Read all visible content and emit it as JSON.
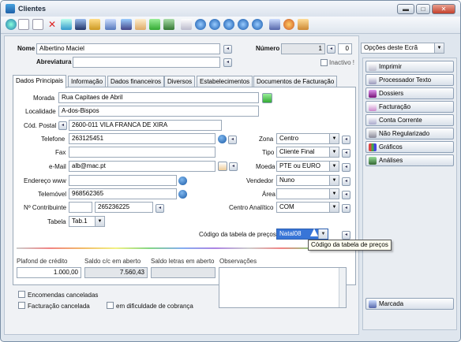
{
  "window": {
    "title": "Clientes",
    "min": "▬",
    "max": "□",
    "close": "✕"
  },
  "header": {
    "nome_label": "Nome",
    "nome_value": "Albertino Maciel",
    "numero_label": "Número",
    "numero_value": "1",
    "numero_extra": "0",
    "abreviatura_label": "Abreviatura",
    "abreviatura_value": "",
    "inactivo_label": "Inactivo !"
  },
  "tabs": [
    {
      "label": "Dados Principais"
    },
    {
      "label": "Informação"
    },
    {
      "label": "Dados financeiros"
    },
    {
      "label": "Diversos"
    },
    {
      "label": "Estabelecimentos"
    },
    {
      "label": "Documentos de Facturação"
    }
  ],
  "form": {
    "morada_label": "Morada",
    "morada_value": "Rua Capitaes de Abril",
    "localidade_label": "Localidade",
    "localidade_value": "A-dos-Bispos",
    "cod_postal_label": "Cód. Postal",
    "cod_postal_value": "2600-011 VILA FRANCA DE XIRA",
    "telefone_label": "Telefone",
    "telefone_value": "263125451",
    "fax_label": "Fax",
    "fax_value": "",
    "email_label": "e-Mail",
    "email_value": "alb@mac.pt",
    "www_label": "Endereço www",
    "www_value": "",
    "telemovel_label": "Telemóvel",
    "telemovel_value": "968562365",
    "contribuinte_label": "Nº Contribuinte",
    "contribuinte_value": "265236225",
    "tabela_label": "Tabela",
    "tabela_value": "Tab.1",
    "zona_label": "Zona",
    "zona_value": "Centro",
    "tipo_label": "Tipo",
    "tipo_value": "Cliente Final",
    "moeda_label": "Moeda",
    "moeda_value": "PTE ou EURO",
    "vendedor_label": "Vendedor",
    "vendedor_value": "Nuno",
    "area_label": "Área",
    "area_value": "",
    "centro_label": "Centro Analítico",
    "centro_value": "COM",
    "cod_tabela_label": "Código da tabela de preços",
    "cod_tabela_value": "Natal08",
    "tooltip": "Código da tabela de preços"
  },
  "bottom": {
    "plafond_label": "Plafond de crédito",
    "plafond_value": "1.000,00",
    "saldo_cc_label": "Saldo c/c em aberto",
    "saldo_cc_value": "7.560,43",
    "saldo_letras_label": "Saldo letras em aberto",
    "saldo_letras_value": "",
    "observacoes_label": "Observações",
    "encomendas_label": "Encomendas canceladas",
    "facturacao_label": "Facturação cancelada",
    "dificuldade_label": "em dificuldade de cobrança"
  },
  "right": {
    "options_label": "Opções deste Ecrã",
    "buttons": [
      {
        "label": "Imprimir"
      },
      {
        "label": "Processador Texto"
      },
      {
        "label": "Dossiers"
      },
      {
        "label": "Facturação"
      },
      {
        "label": "Conta Corrente"
      },
      {
        "label": "Não Regularizado"
      },
      {
        "label": "Gráficos"
      },
      {
        "label": "Análises"
      }
    ],
    "marcada_label": "Marcada"
  }
}
